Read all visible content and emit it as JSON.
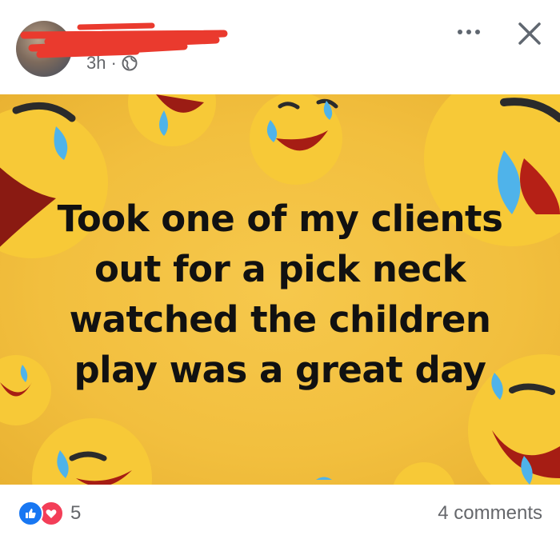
{
  "post": {
    "timestamp": "3h",
    "separator": "·",
    "privacy_icon": "globe-icon",
    "menu_icon": "more-options-icon",
    "close_icon": "close-icon"
  },
  "image": {
    "caption": "Took one of my clients\nout for a pick neck\nwatched the children\nplay was a great day",
    "background_color": "#f2bf3e",
    "emoji": "face-with-tears-of-joy"
  },
  "footer": {
    "reaction_icons": [
      "like-icon",
      "love-icon"
    ],
    "reaction_count": "5",
    "comments_label": "4 comments"
  }
}
